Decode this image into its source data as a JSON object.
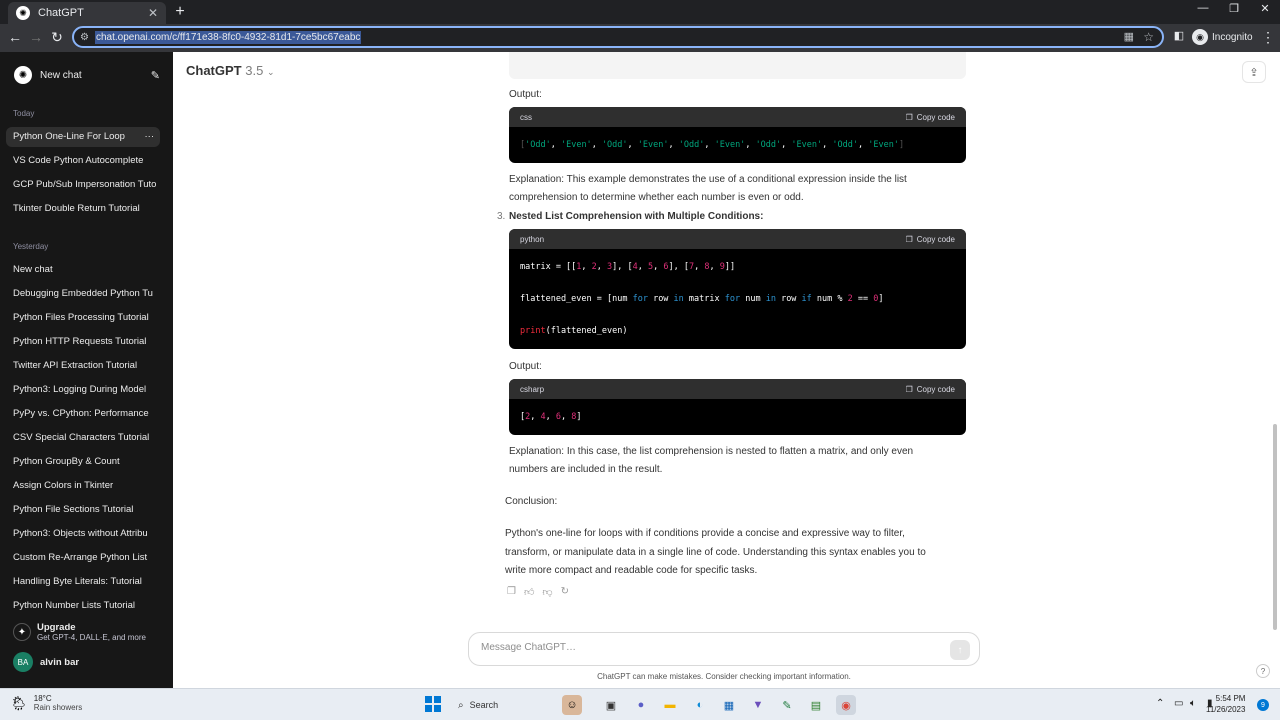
{
  "browser": {
    "tab_title": "ChatGPT",
    "url": "chat.openai.com/c/ff171e38-8fc0-4932-81d1-7ce5bc67eabc",
    "incognito_label": "Incognito"
  },
  "sidebar": {
    "new_chat": "New chat",
    "today_label": "Today",
    "today_items": [
      "Python One-Line For Loop",
      "VS Code Python Autocomplete",
      "GCP Pub/Sub Impersonation Tuto",
      "Tkinter Double Return Tutorial"
    ],
    "yesterday_label": "Yesterday",
    "yesterday_items": [
      "New chat",
      "Debugging Embedded Python Tu",
      "Python Files Processing Tutorial",
      "Python HTTP Requests Tutorial",
      "Twitter API Extraction Tutorial",
      "Python3: Logging During Model",
      "PyPy vs. CPython: Performance",
      "CSV Special Characters Tutorial",
      "Python GroupBy & Count",
      "Assign Colors in Tkinter",
      "Python File Sections Tutorial",
      "Python3: Objects without Attribu",
      "Custom Re-Arrange Python List",
      "Handling Byte Literals: Tutorial",
      "Python Number Lists Tutorial"
    ],
    "upgrade_title": "Upgrade",
    "upgrade_sub": "Get GPT-4, DALL·E, and more",
    "user_initials": "BA",
    "user_name": "alvin bar"
  },
  "header": {
    "model": "ChatGPT",
    "version": "3.5"
  },
  "content": {
    "output_label_1": "Output:",
    "code1_lang": "css",
    "copy_label": "Copy code",
    "explanation_1a": "Explanation: This example demonstrates the use of a conditional expression inside the list",
    "explanation_1b": "comprehension to determine whether each number is even or odd.",
    "item3_number": "3.",
    "item3_title": "Nested List Comprehension with Multiple Conditions:",
    "code2_lang": "python",
    "output_label_2": "Output:",
    "code3_lang": "csharp",
    "explanation_2a": "Explanation: In this case, the list comprehension is nested to flatten a matrix, and only even",
    "explanation_2b": "numbers are included in the result.",
    "conclusion_label": "Conclusion:",
    "conclusion_a": "Python's one-line for loops with if conditions provide a concise and expressive way to filter,",
    "conclusion_b": "transform, or manipulate data in a single line of code. Understanding this syntax enables you to",
    "conclusion_c": "write more compact and readable code for specific tasks."
  },
  "composer": {
    "placeholder": "Message ChatGPT…",
    "disclaimer": "ChatGPT can make mistakes. Consider checking important information."
  },
  "taskbar": {
    "temp": "18°C",
    "weather": "Rain showers",
    "search": "Search",
    "time": "5:54 PM",
    "date": "11/26/2023",
    "notif_count": "9"
  }
}
